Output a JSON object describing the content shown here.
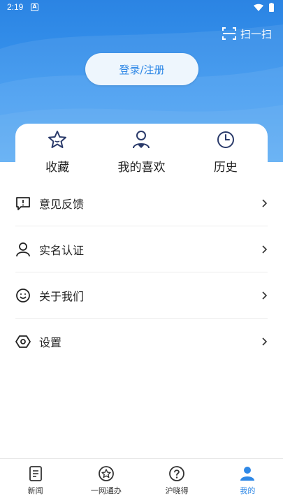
{
  "status_bar": {
    "time": "2:19",
    "notification_badge": "A"
  },
  "header": {
    "scan_label": "扫一扫",
    "login_label": "登录/注册"
  },
  "quick_actions": [
    {
      "label": "收藏",
      "icon": "star-icon"
    },
    {
      "label": "我的喜欢",
      "icon": "user-heart-icon"
    },
    {
      "label": "历史",
      "icon": "clock-icon"
    }
  ],
  "menu": [
    {
      "label": "意见反馈",
      "icon": "feedback-icon"
    },
    {
      "label": "实名认证",
      "icon": "person-icon"
    },
    {
      "label": "关于我们",
      "icon": "smile-icon"
    },
    {
      "label": "设置",
      "icon": "hexagon-settings-icon"
    }
  ],
  "tabs": [
    {
      "label": "新闻",
      "icon": "news-icon",
      "active": false
    },
    {
      "label": "一网通办",
      "icon": "service-icon",
      "active": false
    },
    {
      "label": "沪晓得",
      "icon": "question-icon",
      "active": false
    },
    {
      "label": "我的",
      "icon": "profile-icon",
      "active": true
    }
  ],
  "colors": {
    "primary": "#2f88e6",
    "hero_top": "#2b84e3",
    "text": "#222222"
  }
}
